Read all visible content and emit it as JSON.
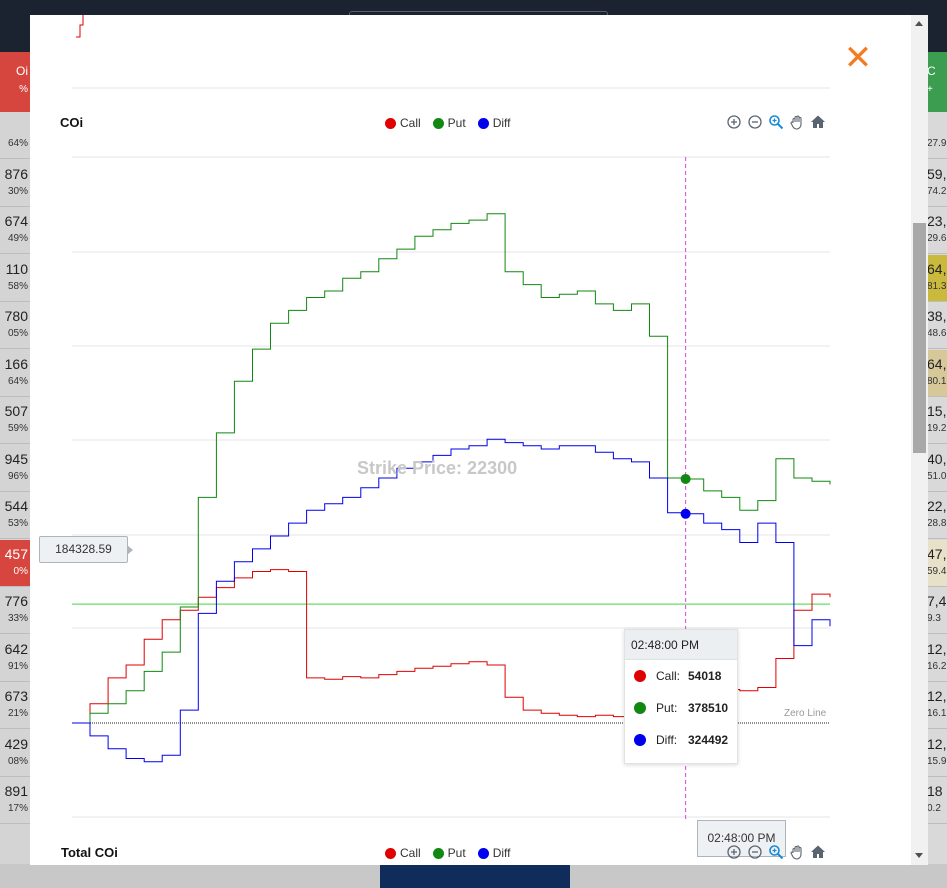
{
  "background": {
    "left_header": [
      "Oi",
      "%"
    ],
    "right_header": [
      "C",
      "+"
    ],
    "left_rows": [
      {
        "value": "",
        "pct": "64%"
      },
      {
        "value": "876",
        "pct": "30%"
      },
      {
        "value": "674",
        "pct": "49%"
      },
      {
        "value": "110",
        "pct": "58%"
      },
      {
        "value": "780",
        "pct": "05%"
      },
      {
        "value": "166",
        "pct": "64%"
      },
      {
        "value": "507",
        "pct": "59%"
      },
      {
        "value": "945",
        "pct": "96%"
      },
      {
        "value": "544",
        "pct": "53%"
      },
      {
        "value": "457",
        "pct": "0%"
      },
      {
        "value": "776",
        "pct": "33%"
      },
      {
        "value": "642",
        "pct": "91%"
      },
      {
        "value": "673",
        "pct": "21%"
      },
      {
        "value": "429",
        "pct": "08%"
      },
      {
        "value": "891",
        "pct": "17%"
      }
    ],
    "right_rows": [
      {
        "value": "",
        "pct": "27.9"
      },
      {
        "value": "59,",
        "pct": "74.2"
      },
      {
        "value": "23,",
        "pct": "29.6"
      },
      {
        "value": "64,",
        "pct": "81.3"
      },
      {
        "value": "38,",
        "pct": "48.6"
      },
      {
        "value": "64,",
        "pct": "80.1"
      },
      {
        "value": "15,",
        "pct": "19.2"
      },
      {
        "value": "40,",
        "pct": "51.0"
      },
      {
        "value": "22,",
        "pct": "28.8"
      },
      {
        "value": "47,",
        "pct": "59.4"
      },
      {
        "value": "7,4",
        "pct": "9.3"
      },
      {
        "value": "12,",
        "pct": "16.2"
      },
      {
        "value": "12,",
        "pct": "16.1"
      },
      {
        "value": "12,",
        "pct": "15.9"
      },
      {
        "value": "18",
        "pct": "0.2"
      }
    ]
  },
  "modal": {
    "close_symbol": "✕",
    "chart1": {
      "title": "COi",
      "legend": [
        {
          "label": "Call",
          "color": "#e00000"
        },
        {
          "label": "Put",
          "color": "#118811"
        },
        {
          "label": "Diff",
          "color": "#0000ee"
        }
      ],
      "toolbar": [
        "zoom-in-icon",
        "zoom-out-icon",
        "magnifier-icon",
        "pan-hand-icon",
        "home-icon"
      ],
      "watermark": "Strike Price: 22300",
      "zero_line_label": "Zero Line",
      "crosshair_price": "184328.59",
      "crosshair_time": "02:48:00 PM",
      "tooltip": {
        "time": "02:48:00 PM",
        "rows": [
          {
            "label": "Call:",
            "value": "54018",
            "color": "#e00000"
          },
          {
            "label": "Put:",
            "value": "378510",
            "color": "#118811"
          },
          {
            "label": "Diff:",
            "value": "324492",
            "color": "#0000ee"
          }
        ]
      }
    },
    "chart2": {
      "title": "Total COi",
      "legend": [
        {
          "label": "Call",
          "color": "#e00000"
        },
        {
          "label": "Put",
          "color": "#118811"
        },
        {
          "label": "Diff",
          "color": "#0000ee"
        }
      ]
    }
  },
  "chart_data": {
    "type": "line",
    "title": "COi",
    "series": [
      {
        "name": "Call",
        "color": "#e00000",
        "values": [
          0,
          30000,
          70000,
          90000,
          130000,
          160000,
          175000,
          195000,
          210000,
          225000,
          235000,
          238000,
          235000,
          70000,
          68000,
          72000,
          70000,
          75000,
          80000,
          85000,
          88000,
          92000,
          95000,
          90000,
          40000,
          20000,
          15000,
          12000,
          10000,
          12000,
          10000,
          8000,
          10000,
          54018,
          54018,
          50000,
          52000,
          50000,
          55000,
          100000,
          175000,
          200000,
          195000
        ]
      },
      {
        "name": "Put",
        "color": "#118811",
        "values": [
          0,
          15000,
          30000,
          50000,
          80000,
          110000,
          180000,
          350000,
          450000,
          530000,
          580000,
          620000,
          640000,
          660000,
          670000,
          690000,
          700000,
          720000,
          735000,
          755000,
          765000,
          775000,
          780000,
          790000,
          700000,
          680000,
          660000,
          665000,
          670000,
          650000,
          640000,
          650000,
          600000,
          380000,
          378510,
          360000,
          350000,
          330000,
          345000,
          410000,
          380000,
          375000,
          370000
        ]
      },
      {
        "name": "Diff",
        "color": "#0000ee",
        "values": [
          0,
          -20000,
          -40000,
          -55000,
          -60000,
          -50000,
          20000,
          170000,
          220000,
          250000,
          270000,
          290000,
          310000,
          330000,
          340000,
          350000,
          365000,
          380000,
          395000,
          405000,
          415000,
          425000,
          430000,
          440000,
          435000,
          430000,
          425000,
          430000,
          430000,
          420000,
          410000,
          405000,
          380000,
          326000,
          324492,
          310000,
          300000,
          280000,
          310000,
          280000,
          120000,
          160000,
          150000
        ]
      }
    ],
    "x_labels": [
      "",
      "02:48:00 PM",
      ""
    ],
    "hover_x": "02:48:00 PM",
    "zero_line": true,
    "reference_line": 184328.59,
    "ylim": [
      -80000,
      850000
    ],
    "grid": true
  }
}
